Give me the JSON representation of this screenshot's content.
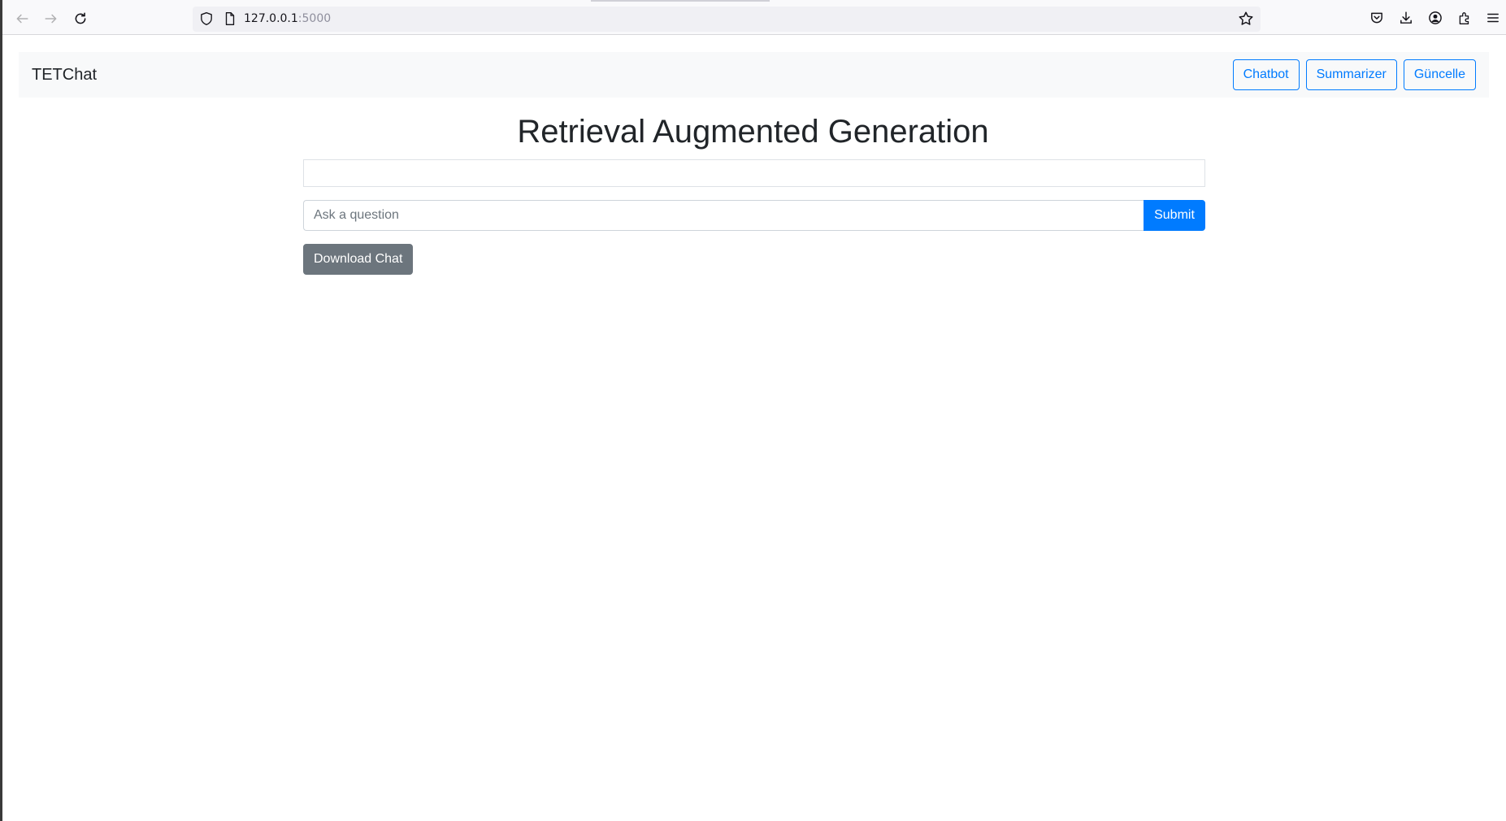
{
  "browser": {
    "url_host": "127.0.0.1",
    "url_port": ":5000"
  },
  "navbar": {
    "brand": "TETChat",
    "buttons": [
      {
        "label": "Chatbot"
      },
      {
        "label": "Summarizer"
      },
      {
        "label": "Güncelle"
      }
    ]
  },
  "main": {
    "title": "Retrieval Augmented Generation",
    "question_placeholder": "Ask a question",
    "question_value": "",
    "submit_label": "Submit",
    "download_label": "Download Chat"
  },
  "colors": {
    "primary": "#007bff",
    "secondary": "#6c757d",
    "navbar_bg": "#f8f9fa",
    "text": "#212529"
  },
  "icons": {
    "back": "back-arrow-icon",
    "forward": "forward-arrow-icon",
    "reload": "reload-icon",
    "shield": "shield-icon",
    "page": "page-icon",
    "bookmark": "star-icon",
    "pocket": "pocket-icon",
    "downloads": "download-icon",
    "account": "account-icon",
    "extensions": "extensions-icon",
    "menu": "hamburger-menu-icon"
  }
}
